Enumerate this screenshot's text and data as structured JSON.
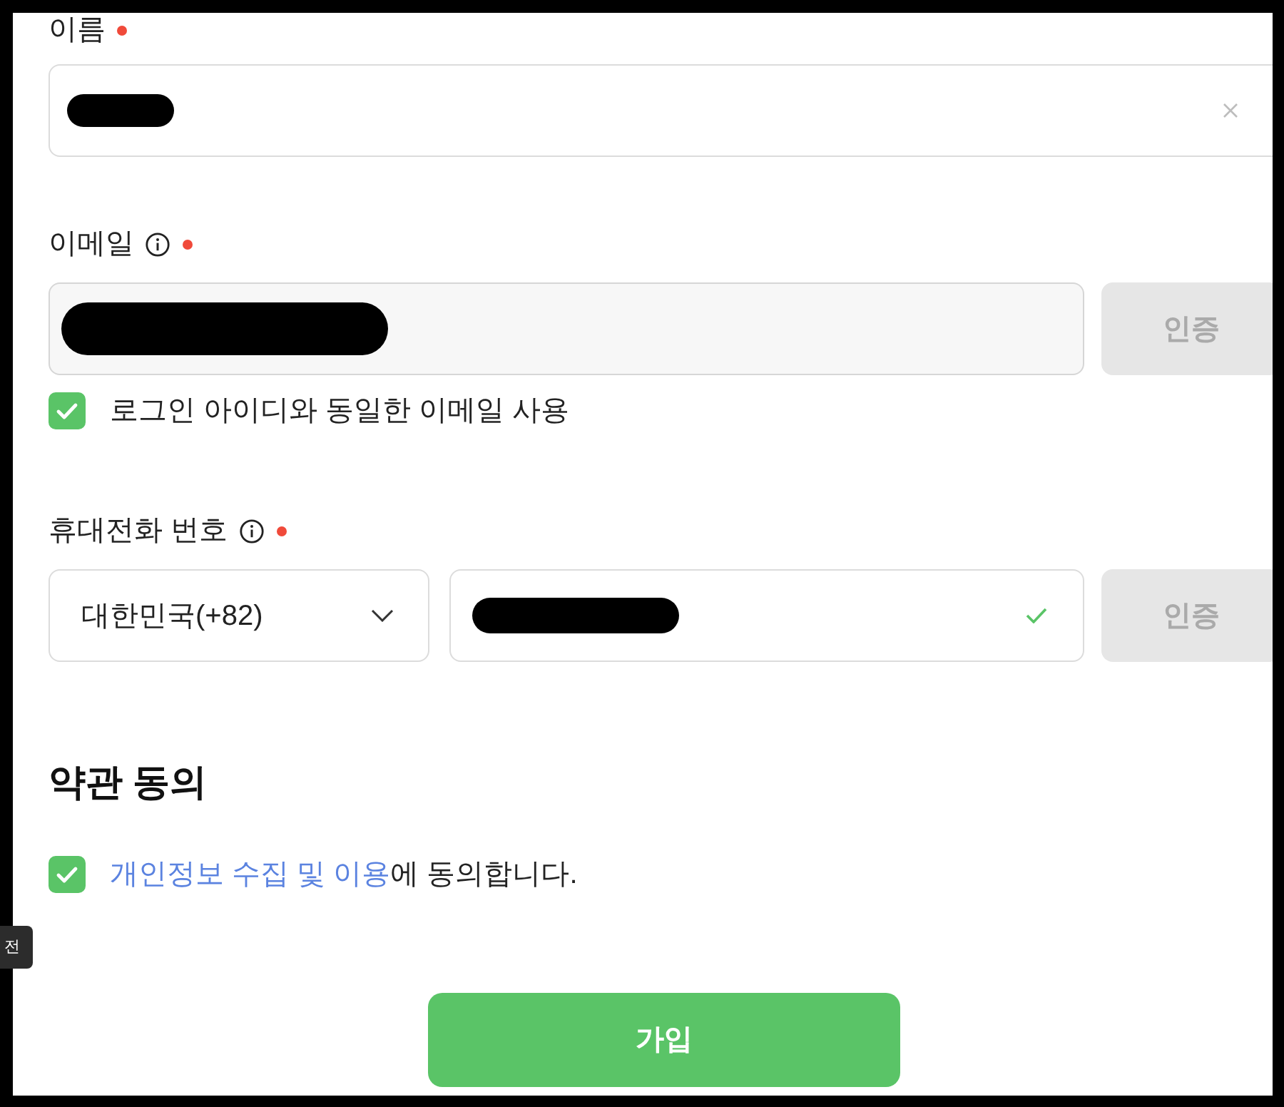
{
  "form": {
    "name": {
      "label": "이름",
      "required": true,
      "redacted": true,
      "clearable": true
    },
    "email": {
      "label": "이메일",
      "info": true,
      "required": true,
      "redacted": true,
      "disabled": true,
      "verify_button": {
        "label": "인증",
        "disabled": true
      },
      "same_as_login": {
        "label": "로그인 아이디와 동일한 이메일 사용",
        "checked": true
      }
    },
    "phone": {
      "label": "휴대전화 번호",
      "info": true,
      "required": true,
      "country": "대한민국(+82)",
      "redacted": true,
      "valid": true,
      "verify_button": {
        "label": "인증",
        "disabled": true
      }
    }
  },
  "terms": {
    "title": "약관 동의",
    "consent": {
      "checked": true,
      "link": "개인정보 수집 및 이용",
      "text": "에 동의합니다."
    }
  },
  "submit_button": "가입",
  "side_tab": {
    "label": "전"
  }
}
